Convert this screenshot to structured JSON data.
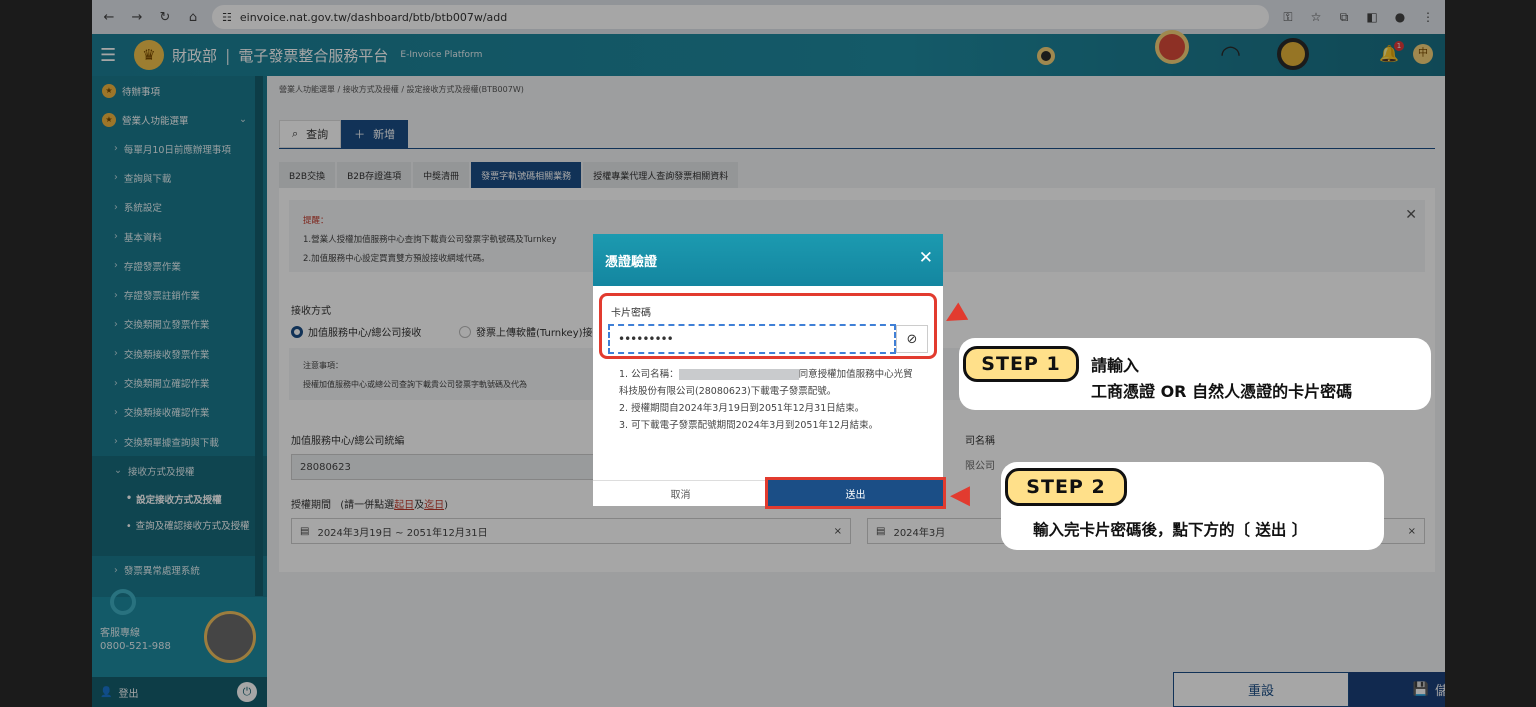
{
  "browser": {
    "url": "einvoice.nat.gov.tw/dashboard/btb/btb007w/add"
  },
  "header": {
    "ministry": "財政部",
    "platform": "電子發票整合服務平台",
    "platform_en": "E-Invoice Platform",
    "user_initial": "中",
    "bell_count": "1"
  },
  "sidebar": {
    "top_items": [
      "待辦事項",
      "營業人功能選單"
    ],
    "sub_items": [
      "每單月10日前應辦理事項",
      "查詢與下載",
      "系統設定",
      "基本資料",
      "存證發票作業",
      "存證發票註銷作業",
      "交換類開立發票作業",
      "交換類接收發票作業",
      "交換類開立確認作業",
      "交換類接收確認作業",
      "交換類單據查詢與下載",
      "接收方式及授權"
    ],
    "leaf_active": "設定接收方式及授權",
    "leaf_other": "查詢及確認接收方式及授權",
    "last_item": "發票異常處理系統",
    "service_label": "客服專線",
    "service_phone": "0800-521-988",
    "logout": "登出"
  },
  "main": {
    "breadcrumb": "營業人功能選單 / 接收方式及授權 / 設定接收方式及授權(BTB007W)",
    "tab_query": "查詢",
    "tab_add": "新增",
    "sub_tabs": [
      "B2B交換",
      "B2B存證進項",
      "中獎清冊",
      "發票字軌號碼相關業務",
      "授權專業代理人查詢發票相關資料"
    ],
    "notice_title": "提醒：",
    "notice_lines": [
      "1.營業人授權加值服務中心查詢下載貴公司發票字軌號碼及Turnkey",
      "2.加值服務中心設定買賣雙方預設接收網域代碼。"
    ],
    "receive_label": "接收方式",
    "radio_1": "加值服務中心/總公司接收",
    "radio_2": "發票上傳軟體(Turnkey)接",
    "note_title": "注意事項：",
    "note_text": "授權加值服務中心或總公司查詢下載貴公司發票字軌號碼及代為",
    "tax_id_label": "加值服務中心/總公司統編",
    "tax_id_value": "28080623",
    "company_label": "司名稱",
    "company_value": "限公司",
    "period_label": "授權期間",
    "period_hint_prefix": "(請一併點選",
    "period_hint_start": "起日",
    "period_hint_and": "及",
    "period_hint_end": "迄日",
    "period_hint_suffix": ")",
    "period_value": "2024年3月19日 ~ 2051年12月31日",
    "month_value": "2024年3月",
    "reset": "重設",
    "save": "儲存"
  },
  "modal": {
    "title": "憑證驗證",
    "field_label": "卡片密碼",
    "password_mask": "•••••••••",
    "list": [
      {
        "num": "1.",
        "pre": "公司名稱：",
        "post": "同意授權加值服務中心光貿科技股份有限公司(28080623)下載電子發票配號。"
      },
      {
        "num": "2.",
        "pre": "授權期間自2024年3月19日到2051年12月31日結束。",
        "post": ""
      },
      {
        "num": "3.",
        "pre": "可下載電子發票配號期間2024年3月到2051年12月結束。",
        "post": ""
      }
    ],
    "cancel": "取消",
    "submit": "送出"
  },
  "annotations": {
    "step1_label": "STEP 1",
    "step1_line1": "請輸入",
    "step1_line2": "工商憑證 OR 自然人憑證的卡片密碼",
    "step2_label": "STEP 2",
    "step2_text": "輸入完卡片密碼後，點下方的〔 送出 〕"
  },
  "colors": {
    "header": "#1d7f95",
    "sidebar": "#1b7a8e",
    "primary": "#1b4e86",
    "highlight": "#e23b2f",
    "step_badge": "#ffe08a"
  }
}
